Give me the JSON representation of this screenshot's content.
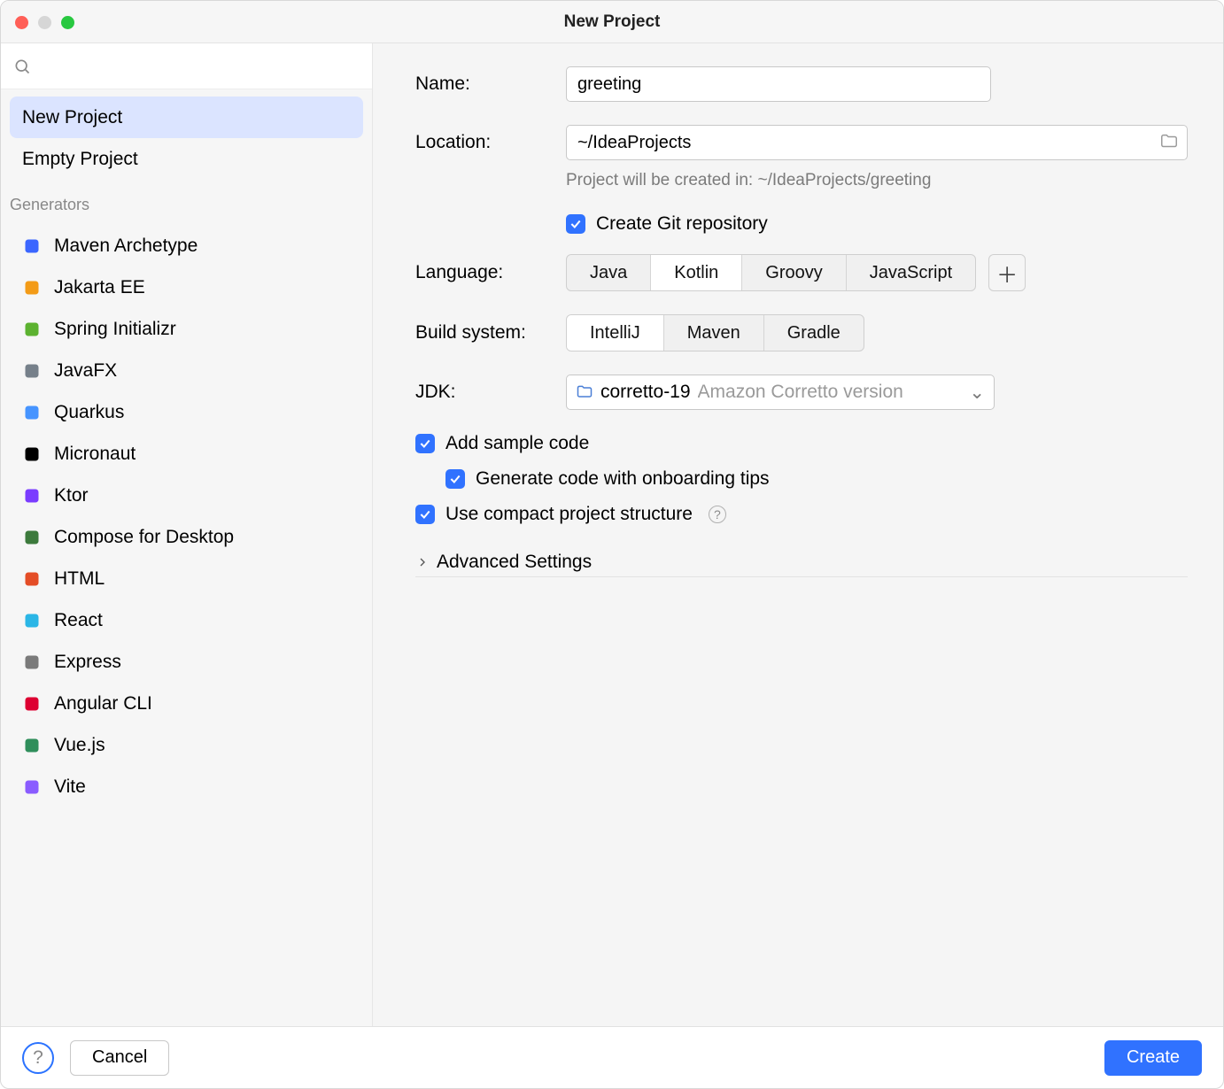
{
  "window": {
    "title": "New Project"
  },
  "sidebar": {
    "projects": [
      {
        "label": "New Project"
      },
      {
        "label": "Empty Project"
      }
    ],
    "generators_header": "Generators",
    "generators": [
      {
        "label": "Maven Archetype",
        "icon": "maven-archetype-icon",
        "color": "#3b66ff"
      },
      {
        "label": "Jakarta EE",
        "icon": "jakarta-ee-icon",
        "color": "#f39b17"
      },
      {
        "label": "Spring Initializr",
        "icon": "spring-icon",
        "color": "#5cb230"
      },
      {
        "label": "JavaFX",
        "icon": "javafx-icon",
        "color": "#76808a"
      },
      {
        "label": "Quarkus",
        "icon": "quarkus-icon",
        "color": "#4694ff"
      },
      {
        "label": "Micronaut",
        "icon": "micronaut-icon",
        "color": "#000000"
      },
      {
        "label": "Ktor",
        "icon": "ktor-icon",
        "color": "#7a3cff"
      },
      {
        "label": "Compose for Desktop",
        "icon": "compose-icon",
        "color": "#3c7a3c"
      },
      {
        "label": "HTML",
        "icon": "html-icon",
        "color": "#e44d26"
      },
      {
        "label": "React",
        "icon": "react-icon",
        "color": "#2bb6e6"
      },
      {
        "label": "Express",
        "icon": "express-icon",
        "color": "#7a7a7a"
      },
      {
        "label": "Angular CLI",
        "icon": "angular-icon",
        "color": "#dd0031"
      },
      {
        "label": "Vue.js",
        "icon": "vue-icon",
        "color": "#2f8e5b"
      },
      {
        "label": "Vite",
        "icon": "vite-icon",
        "color": "#8a5cff"
      }
    ]
  },
  "form": {
    "name_label": "Name:",
    "name_value": "greeting",
    "location_label": "Location:",
    "location_value": "~/IdeaProjects",
    "location_hint": "Project will be created in: ~/IdeaProjects/greeting",
    "git_label": "Create Git repository",
    "language_label": "Language:",
    "language_options": [
      "Java",
      "Kotlin",
      "Groovy",
      "JavaScript"
    ],
    "language_selected": "Kotlin",
    "build_label": "Build system:",
    "build_options": [
      "IntelliJ",
      "Maven",
      "Gradle"
    ],
    "build_selected": "IntelliJ",
    "jdk_label": "JDK:",
    "jdk_value": "corretto-19",
    "jdk_detail": "Amazon Corretto version",
    "add_sample_label": "Add sample code",
    "onboarding_label": "Generate code with onboarding tips",
    "compact_label": "Use compact project structure",
    "advanced_label": "Advanced Settings"
  },
  "footer": {
    "cancel": "Cancel",
    "create": "Create"
  }
}
